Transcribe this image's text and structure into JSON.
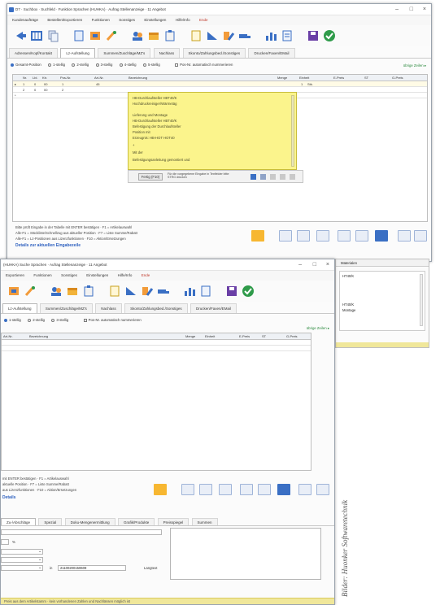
{
  "window_a": {
    "title": "D7 · Suchbox · Suchfeld · Funktion Sprachen (HUHKA) · Aufrag Stellenanzeige · 11 Angebot",
    "menu": [
      "Kundenaufträge",
      "Bestellen/Exportieren",
      "Funktionen",
      "Sonstiges",
      "Einstellungen",
      "Hilfe/Info",
      "Ende"
    ],
    "tabs": [
      "Adressen/Kopf/Kontakt",
      "Lz-Aufstellung",
      "Summen/Zuschläge/MZ's",
      "Nachlass",
      "Skonto/Zahlungsbed./Sonstiges",
      "Drucken/Faxen/EMail"
    ],
    "options": [
      "Gesamt-Position",
      "1-stellig",
      "2-stellig",
      "3-stellig",
      "4-stellig",
      "5-stellig"
    ],
    "checkbox_label": "Pos-Nr. automatisch nummerieren",
    "link_right": "übrige Zeilen ▸",
    "grid_headers": [
      "Nr.",
      "Lbl.",
      "Ktr.",
      "Pos-Nr.",
      "Art-Nr.",
      "Bezeichnung",
      "Menge",
      "Einheit",
      "E-Preis",
      "ST",
      "G-Preis"
    ],
    "grid_rows": [
      {
        "nr": "1",
        "lbl": "0",
        "ktr": "00",
        "pos": "1",
        "art": "45",
        "menge": "1",
        "einheit": "Stk."
      },
      {
        "nr": "2",
        "lbl": "0",
        "ktr": "00",
        "pos": "2",
        "art": "",
        "menge": "",
        "einheit": ""
      }
    ],
    "popup_lines": [
      "HB-Durchlaufsteller HBT40/K",
      "Hochdruckreiniger/Wärmetäg",
      "",
      "Lieferung und Montage",
      "HB-Durchlaufsteller HBT40/K",
      "Befestigung der Durchlaufsteller",
      "Position mit",
      "Erzeugnis: HB-HOT HOT40",
      "+",
      "Mit der",
      "Befestigungsanleitung gemontiert und"
    ],
    "popup_button": "Fertig (F10)",
    "popup_hint": "Für die vorgegebene Eingabe in Textfelder bitte STRG drücken",
    "footer_hint_1": "Bitte prüft Eingabe in der Tabelle mit ENTER bestätigen · F1 = Artikelauswahl",
    "footer_hint_2": "Alle-F1 = Stückliste/Schnellzug aus aktueller Position · F7 = Liste Summe/Rabatt",
    "footer_hint_3": "Alle-F1 = Lz-Positionen aus Lizenzfunktionen · F10 = Aktion/Ersetzungen",
    "detail_link": "Details zur aktuellen Eingabezeile",
    "colors": {
      "popup": "#fbf48c",
      "accent": "#3a6fc4",
      "status": "#f0e79a"
    }
  },
  "window_b": {
    "title": "(HUHKA) Suche Sprachen · Aufrag Stellenanzeige · 11 Angebot",
    "menu": [
      "Exportieren",
      "Funktionen",
      "Sonstiges",
      "Einstellungen",
      "Hilfe/Info",
      "Ende"
    ],
    "tabs": [
      "Lz-Aufstellung",
      "Summen/Zuschläge/MZ's",
      "Nachlass",
      "Skonto/Zahlungsbed./Sonstiges",
      "Drucken/Faxen/EMail"
    ],
    "options": [
      "1-stellig",
      "2-stellig",
      "3-stellig"
    ],
    "checkbox_label": "Pos-Nr. automatisch nummerieren",
    "link_right": "übrige Zeilen ▸",
    "grid_headers": [
      "Art-Nr.",
      "Bezeichnung",
      "Menge",
      "Einheit",
      "E-Preis",
      "ST",
      "G-Preis"
    ],
    "footer_hint_1": "mit ENTER bestätigen · F1 = Artikelauswahl",
    "footer_hint_2": "aktuelle Position · F7 = Liste Summe/Rabatt",
    "footer_hint_3": "aus Lizenzfunktionen · F10 = Aktion/Ersetzungen",
    "detail_link": "Details",
    "bottom_tabs": [
      "Zu-/Abschläge",
      "Spezial",
      "Doku-Mengenermittlung",
      "Grafik/Produkte",
      "Preisspiegel",
      "Summen"
    ],
    "percent_sign": "%",
    "code_label": "in",
    "code_value": "21100200150609",
    "lang_label": "Langtext",
    "status": "Preis aus dem Artikelstamm · kein vorhandenen Zahlen und Nachlässen möglich ist",
    "side_panel_lines": [
      "Materialen",
      "HT40/K",
      "",
      "",
      "HT40/K",
      "Montage"
    ]
  },
  "credit": "Bilder: Huonker Softwaretechnik"
}
